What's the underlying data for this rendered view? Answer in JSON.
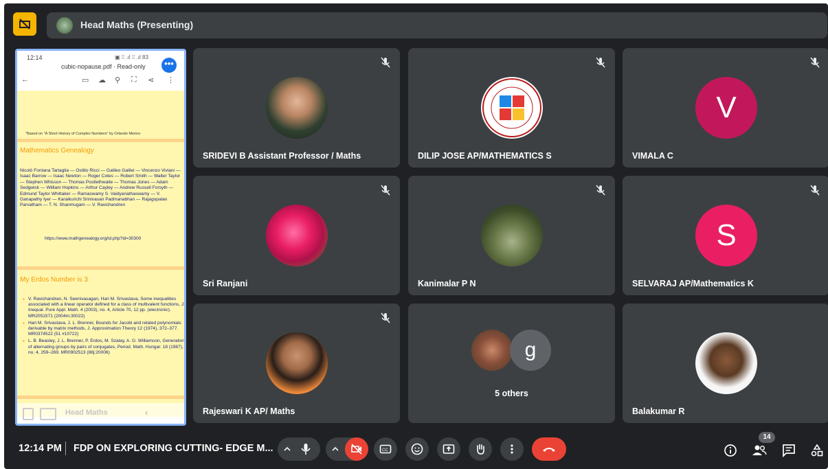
{
  "header": {
    "presenter_label": "Head Maths (Presenting)"
  },
  "share": {
    "status_time": "12:14",
    "status_icons": "▣ ⁞⁞ .ıl ⁞⁞ .ıl 83",
    "file_name": "cubic-nopause.pdf · Read-only",
    "slide1_credit": "\"Based on \"A Short History of Complex Numbers\" by Orlando Merino",
    "genealogy_title": "Mathematics Genealogy",
    "genealogy_text": "Nicolò Fontana Tartaglia — Ostilio Ricci — Galileo Galilei — Vincenzo Viviani — Isaac Barrow — Isaac Newton — Roger Cotes — Robert Smith — Walter Taylor — Stephen Whisson — Thomas Postlethwaite — Thomas Jones — Adam Sedgwick — William Hopkins — Arthur Cayley — Andrew Russell Forsyth — Edmund Taylor Whittaker — Ramaswamy S. Vaidyanathaswamy — V. Ganapathy Iyer — Karaikurichi Srinivasan Padmanabhan — Rajagopalan Parvatham — T. N. Shanmugam — V. Ravichandren",
    "genealogy_link": "https://www.mathgenealogy.org/id.php?id=30300",
    "erdos_title": "My Erdos Number is 3",
    "erdos_items": [
      "V. Ravichandran, N. Seenivasagan, Hari M. Srivastava, Some inequalities associated with a linear operator defined for a class of multivalent functions, J. Inequal. Pure Appl. Math. 4 (2003), no. 4, Article 70, 12 pp. (electronic). MR2051571 (2004m:30022)",
      "Hari M. Srivastava, J. L. Brenner, Bounds for Jacobi and related polynomials derivable by matrix methods, J. Approximation Theory 12 (1974), 372–377. MR0374522 (51 #10722)",
      "L. B. Beasley, J. L. Brenner, P. Erdos, M. Szalay, A. G. Williamson, Generation of alternating groups by pairs of conjugates, Period. Math. Hungar. 18 (1987), no. 4, 259–269. MR0902513 (88j:20006)"
    ],
    "footer_label": "Head Maths"
  },
  "tiles": [
    {
      "name": "SRIDEVI B Assistant Professor / Maths",
      "avatar": "photo-boy"
    },
    {
      "name": "DILIP JOSE AP/MATHEMATICS S",
      "avatar": "institute-logo"
    },
    {
      "name": "VIMALA C",
      "avatar_letter": "V",
      "avatar_color": "#c2185b"
    },
    {
      "name": "Sri Ranjani",
      "avatar": "photo-flowers"
    },
    {
      "name": "Kanimalar P N",
      "avatar": "photo-stream"
    },
    {
      "name": "SELVARAJ AP/Mathematics K",
      "avatar_letter": "S",
      "avatar_color": "#e91e63"
    },
    {
      "name": "Rajeswari K AP/ Maths",
      "avatar": "photo-woman"
    },
    {
      "name": "5 others",
      "avatar_letter": "g",
      "avatar_color": "#5f6368"
    },
    {
      "name": "Balakumar R",
      "avatar": "photo-man"
    }
  ],
  "bottom": {
    "time": "12:14 PM",
    "meeting_title": "FDP ON EXPLORING CUTTING- EDGE M...",
    "participants_count": "14"
  },
  "colors": {
    "end_call": "#ea4335",
    "presenter_pin": "#f4b400",
    "share_border": "#8ab4f8"
  }
}
